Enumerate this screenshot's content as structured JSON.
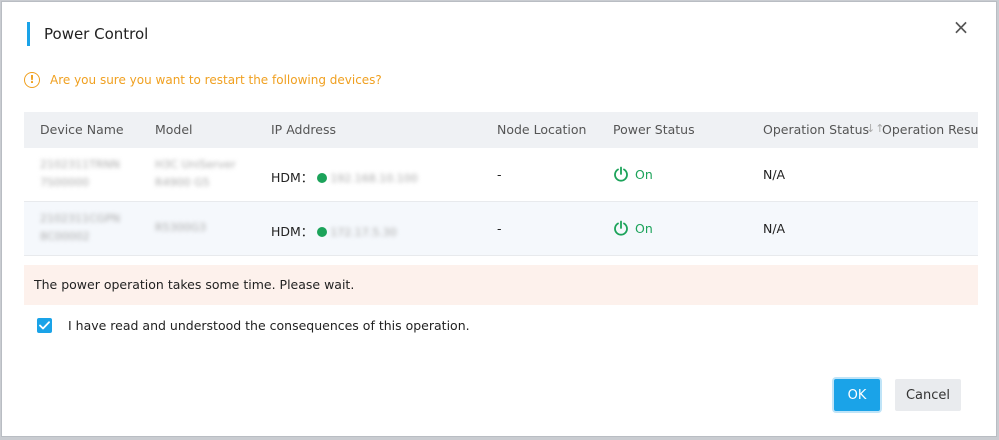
{
  "dialog": {
    "title": "Power Control",
    "close_glyph": "×",
    "warning_icon_glyph": "!",
    "warning": "Are you sure you want to restart the following devices?",
    "notice": "The power operation takes some time. Please wait.",
    "confirm_text": "I have read and understood the consequences of this operation.",
    "confirm_checked": true,
    "ok_label": "OK",
    "cancel_label": "Cancel"
  },
  "table": {
    "headers": {
      "device_name": "Device Name",
      "model": "Model",
      "ip_address": "IP Address",
      "node_location": "Node Location",
      "power_status": "Power Status",
      "operation_status": "Operation Status",
      "sort_glyph": "↓↑",
      "operation_result": "Operation Result"
    },
    "rows": [
      {
        "device_name_line1": "2102311TRNN",
        "device_name_line2": "7S00000",
        "model_line1": "H3C UniServer",
        "model_line2": "R4900 G5",
        "ip_prefix": "HDM：",
        "ip": "192.168.10.100",
        "node_location": "-",
        "power_status": "On",
        "operation_status": "N/A",
        "operation_result": ""
      },
      {
        "device_name_line1": "2102311CGPN",
        "device_name_line2": "8C00002",
        "model_line1": "R5300G3",
        "model_line2": "",
        "ip_prefix": "HDM：",
        "ip": "172.17.5.30",
        "node_location": "-",
        "power_status": "On",
        "operation_status": "N/A",
        "operation_result": ""
      }
    ]
  },
  "colors": {
    "accent": "#1aa3e8",
    "warning": "#f0a020",
    "power_on": "#1ca35a",
    "notice_bg": "#fdf1ec"
  },
  "icons": {
    "close": "close-icon",
    "warning": "warning-icon",
    "power": "power-icon",
    "status_dot": "status-dot-icon",
    "sort": "sort-icon",
    "checkbox": "checkmark-icon"
  }
}
